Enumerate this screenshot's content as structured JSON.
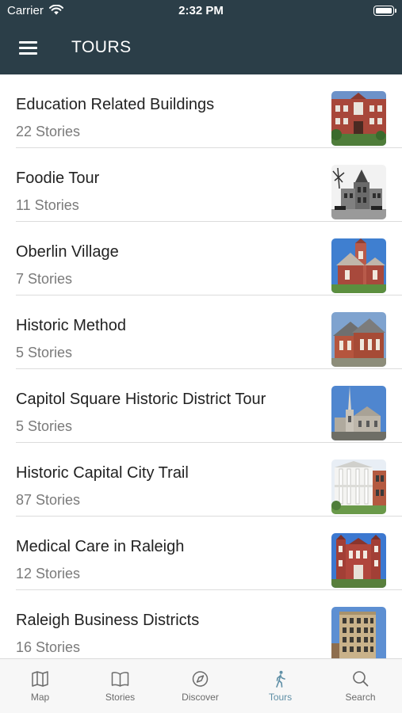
{
  "status_bar": {
    "carrier": "Carrier",
    "time": "2:32 PM"
  },
  "header": {
    "title": "TOURS"
  },
  "tours": [
    {
      "title": "Education Related Buildings",
      "stories": "22 Stories"
    },
    {
      "title": "Foodie Tour",
      "stories": "11 Stories"
    },
    {
      "title": "Oberlin Village",
      "stories": "7 Stories"
    },
    {
      "title": "Historic Method",
      "stories": "5 Stories"
    },
    {
      "title": "Capitol Square Historic District Tour",
      "stories": "5 Stories"
    },
    {
      "title": "Historic Capital City Trail",
      "stories": "87 Stories"
    },
    {
      "title": "Medical Care in Raleigh",
      "stories": "12 Stories"
    },
    {
      "title": "Raleigh Business Districts",
      "stories": "16 Stories"
    }
  ],
  "tab_bar": {
    "active": "Tours",
    "active_color": "#5f8fa6",
    "items": [
      {
        "label": "Map",
        "icon": "map-icon"
      },
      {
        "label": "Stories",
        "icon": "book-icon"
      },
      {
        "label": "Discover",
        "icon": "compass-icon"
      },
      {
        "label": "Tours",
        "icon": "walker-icon"
      },
      {
        "label": "Search",
        "icon": "search-icon"
      }
    ]
  },
  "colors": {
    "header_bg": "#2b3e48"
  }
}
